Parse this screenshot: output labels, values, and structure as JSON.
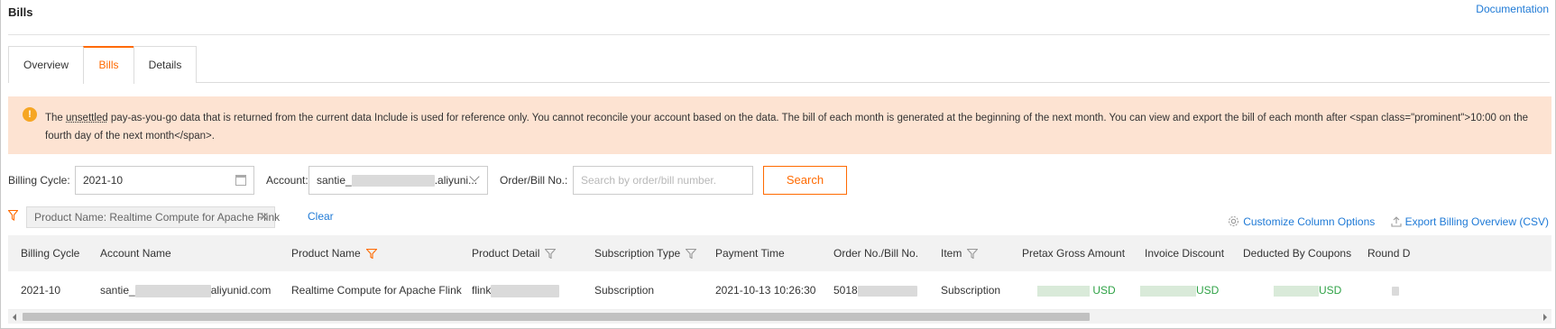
{
  "page": {
    "title": "Bills",
    "documentation_link": "Documentation"
  },
  "tabs": [
    {
      "label": "Overview",
      "active": false
    },
    {
      "label": "Bills",
      "active": true
    },
    {
      "label": "Details",
      "active": false
    }
  ],
  "notice": {
    "text_before": "The ",
    "underlined": "unsettled",
    "text_after": " pay-as-you-go data that is returned from the current data Include is used for reference only. You cannot reconcile your account based on the data. The bill of each month is generated at the beginning of the next month. You can view and export the bill of each month after <span class=\"prominent\">10:00 on the fourth day of the next month</span>.",
    "icon": "info-icon",
    "background_color": "#fde3d2"
  },
  "filters": {
    "billing_cycle_label": "Billing Cycle:",
    "billing_cycle_value": "2021-10",
    "account_label": "Account:",
    "account_value_prefix": "santie_",
    "account_value_suffix": ".aliyuni...",
    "order_label": "Order/Bill No.:",
    "order_placeholder": "Search by order/bill number.",
    "search_button": "Search"
  },
  "active_filter": {
    "chip_label": "Product Name: Realtime Compute for Apache Flink",
    "clear_label": "Clear"
  },
  "toolbar": {
    "customize_columns": "Customize Column Options",
    "export": "Export Billing Overview (CSV)"
  },
  "table": {
    "columns": [
      "Billing Cycle",
      "Account Name",
      "Product Name",
      "Product Detail",
      "Subscription Type",
      "Payment Time",
      "Order No./Bill No.",
      "Item",
      "Pretax Gross Amount",
      "Invoice Discount",
      "Deducted By Coupons",
      "Round D"
    ],
    "rows": [
      {
        "billing_cycle": "2021-10",
        "account_prefix": "santie_",
        "account_suffix": "aliyunid.com",
        "product_name": "Realtime Compute for Apache Flink",
        "product_detail_prefix": "flink",
        "subscription_type": "Subscription",
        "payment_time": "2021-10-13 10:26:30",
        "order_prefix": "5018",
        "item": "Subscription",
        "pretax_currency": "USD",
        "invoice_currency": "USD",
        "coupon_currency": "USD"
      }
    ]
  },
  "colors": {
    "accent": "#ff6a00",
    "link": "#1f7ad6",
    "amount": "#2fa246"
  }
}
